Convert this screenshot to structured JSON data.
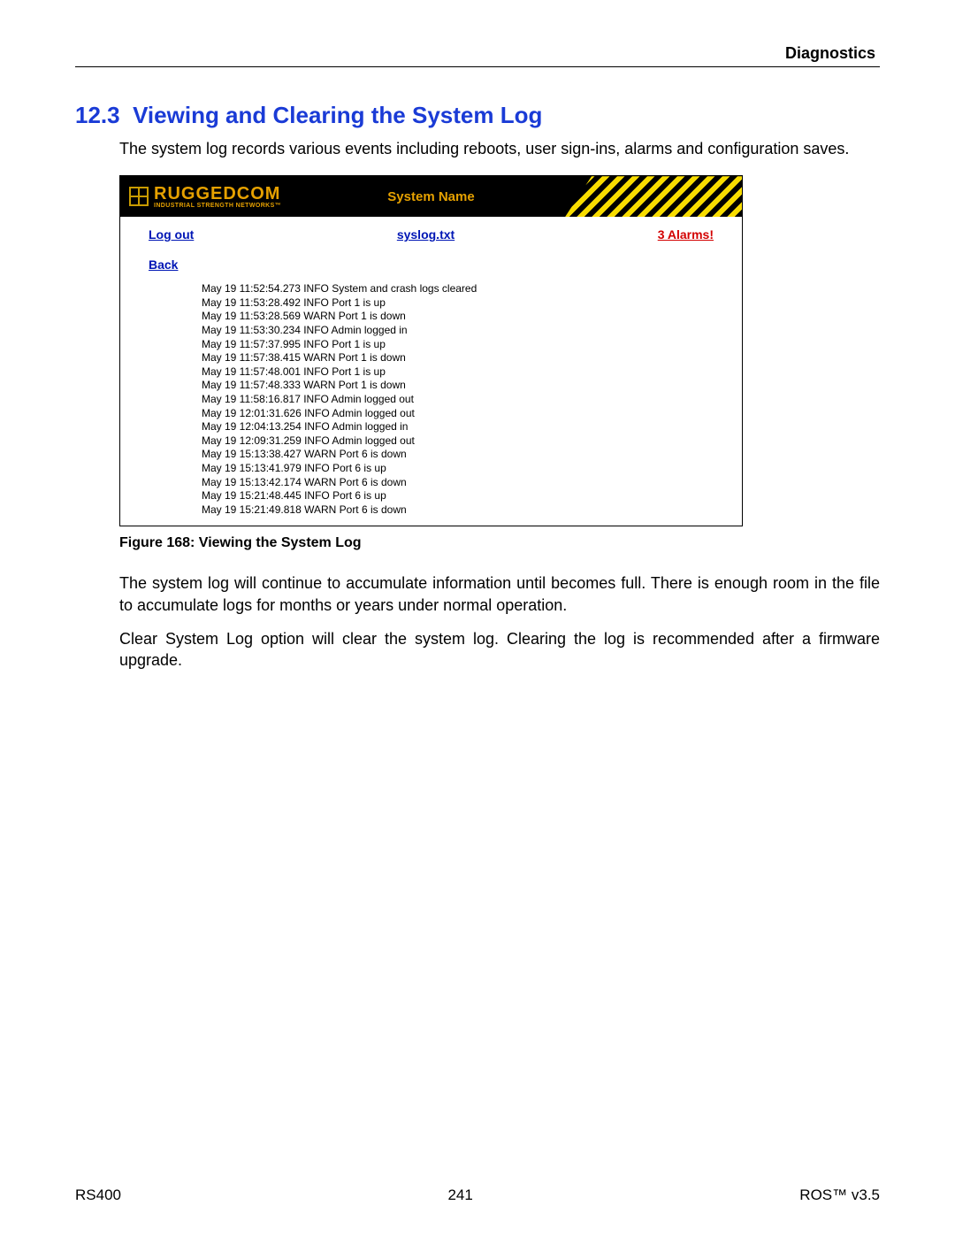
{
  "header": {
    "section_label": "Diagnostics"
  },
  "section": {
    "number": "12.3",
    "title": "Viewing and Clearing the System Log"
  },
  "paragraphs": {
    "intro": "The system log records various events including reboots, user sign-ins, alarms and configuration saves.",
    "p2": "The system log will continue to accumulate information until becomes full. There is enough room in the file to accumulate logs for months or years under normal operation.",
    "p3": "Clear System Log option will clear the system log. Clearing the log is recommended after a firmware upgrade."
  },
  "figure": {
    "caption": "Figure 168: Viewing the System Log"
  },
  "screenshot": {
    "logo_brand": "RUGGEDCOM",
    "logo_tagline": "INDUSTRIAL STRENGTH NETWORKS™",
    "title": "System Name",
    "links": {
      "logout": "Log out",
      "file": "syslog.txt",
      "alarms": "3 Alarms!",
      "back": "Back"
    },
    "log_lines": [
      "May 19 11:52:54.273 INFO System and crash logs cleared",
      "May 19 11:53:28.492 INFO Port 1 is up",
      "May 19 11:53:28.569 WARN Port 1 is down",
      "May 19 11:53:30.234 INFO Admin logged in",
      "May 19 11:57:37.995 INFO Port 1 is up",
      "May 19 11:57:38.415 WARN Port 1 is down",
      "May 19 11:57:48.001 INFO Port 1 is up",
      "May 19 11:57:48.333 WARN Port 1 is down",
      "May 19 11:58:16.817 INFO Admin logged out",
      "May 19 12:01:31.626 INFO Admin logged out",
      "May 19 12:04:13.254 INFO Admin logged in",
      "May 19 12:09:31.259 INFO Admin logged out",
      "May 19 15:13:38.427 WARN Port 6 is down",
      "May 19 15:13:41.979 INFO Port 6 is up",
      "May 19 15:13:42.174 WARN Port 6 is down",
      "May 19 15:21:48.445 INFO Port 6 is up",
      "May 19 15:21:49.818 WARN Port 6 is down"
    ]
  },
  "footer": {
    "left": "RS400",
    "center": "241",
    "right": "ROS™  v3.5"
  }
}
